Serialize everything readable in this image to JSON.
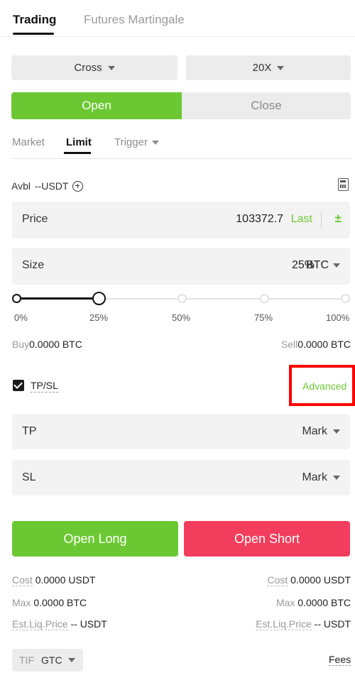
{
  "tabs": {
    "active": "Trading",
    "inactive": "Futures Martingale"
  },
  "selectors": {
    "margin_mode": "Cross",
    "leverage": "20X"
  },
  "side": {
    "open": "Open",
    "close": "Close"
  },
  "order_types": {
    "market": "Market",
    "limit": "Limit",
    "trigger": "Trigger"
  },
  "available": {
    "label": "Avbl",
    "value": "--USDT"
  },
  "price": {
    "label": "Price",
    "value": "103372.7",
    "last": "Last"
  },
  "size": {
    "label": "Size",
    "value": "25%",
    "unit": "BTC",
    "slider_fraction": 0.25
  },
  "slider_marks": [
    "0%",
    "25%",
    "50%",
    "75%",
    "100%"
  ],
  "buy": {
    "label": "Buy",
    "value": "0.0000 BTC"
  },
  "sell": {
    "label": "Sell",
    "value": "0.0000 BTC"
  },
  "tpsl": {
    "label": "TP/SL",
    "checked": true,
    "advanced": "Advanced"
  },
  "tp": {
    "label": "TP",
    "trigger": "Mark"
  },
  "sl": {
    "label": "SL",
    "trigger": "Mark"
  },
  "actions": {
    "long": "Open Long",
    "short": "Open Short"
  },
  "long_info": {
    "cost_label": "Cost",
    "cost_value": "0.0000 USDT",
    "max_label": "Max",
    "max_value": "0.0000 BTC",
    "liq_label": "Est.Liq.Price",
    "liq_value": "-- USDT"
  },
  "short_info": {
    "cost_label": "Cost",
    "cost_value": "0.0000 USDT",
    "max_label": "Max",
    "max_value": "0.0000 BTC",
    "liq_label": "Est.Liq.Price",
    "liq_value": "-- USDT"
  },
  "tif": {
    "label": "TIF",
    "value": "GTC"
  },
  "fees": "Fees",
  "colors": {
    "accent_green": "#6cc832",
    "short_red": "#f23d5c",
    "highlight": "#ff0000"
  }
}
